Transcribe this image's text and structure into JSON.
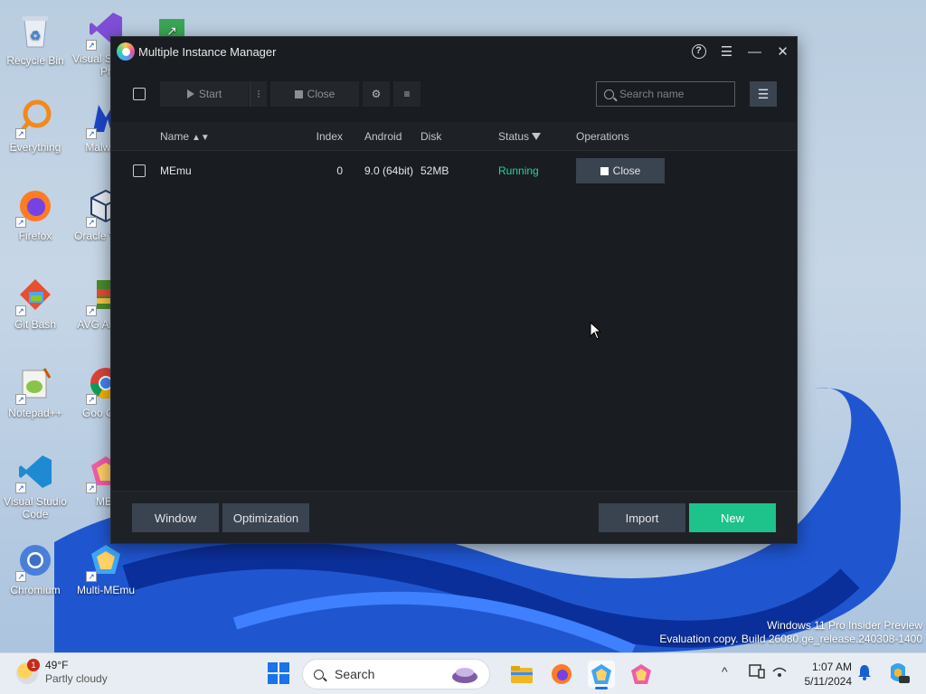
{
  "desktop": {
    "icons": [
      {
        "label": "Recycle Bin",
        "icon": "recycle-bin-icon"
      },
      {
        "label": "Visual S 2022 Pr",
        "icon": "visual-studio-icon"
      },
      {
        "label": "Everything",
        "icon": "everything-search-icon"
      },
      {
        "label": "Malware",
        "icon": "malwarebytes-icon"
      },
      {
        "label": "Firefox",
        "icon": "firefox-icon"
      },
      {
        "label": "Oracle Virtua",
        "icon": "virtualbox-icon"
      },
      {
        "label": "Git Bash",
        "icon": "git-bash-icon"
      },
      {
        "label": "AVG An Fre",
        "icon": "avg-antivirus-icon"
      },
      {
        "label": "Notepad++",
        "icon": "notepad-plus-plus-icon"
      },
      {
        "label": "Goo Chro",
        "icon": "google-chrome-icon"
      },
      {
        "label": "Visual Studio Code",
        "icon": "vscode-icon"
      },
      {
        "label": "MEr",
        "icon": "memu-icon"
      },
      {
        "label": "Chromium",
        "icon": "chromium-icon"
      },
      {
        "label": "Multi-MEmu",
        "icon": "multi-memu-icon"
      }
    ],
    "watermark_line1": "Windows 11 Pro Insider Preview",
    "watermark_line2": "Evaluation copy. Build 26080.ge_release.240308-1400"
  },
  "window": {
    "title": "Multiple Instance Manager",
    "help_label": "?",
    "menu_label": "☰",
    "minimize_label": "—",
    "close_label": "✕"
  },
  "toolbar": {
    "start_label": "Start",
    "more_label": "⁝",
    "close_label": "Close",
    "gear_label": "⚙",
    "menu_label": "≡",
    "search_placeholder": "Search name",
    "view_label": "☰"
  },
  "table": {
    "columns": {
      "name": "Name",
      "index": "Index",
      "android": "Android",
      "disk": "Disk",
      "status": "Status",
      "operations": "Operations"
    },
    "rows": [
      {
        "name": "MEmu",
        "index": "0",
        "android": "9.0 (64bit)",
        "disk": "52MB",
        "status": "Running",
        "op_label": "Close"
      }
    ]
  },
  "footer": {
    "window_label": "Window",
    "optimization_label": "Optimization",
    "import_label": "Import",
    "new_label": "New"
  },
  "taskbar": {
    "weather_temp": "49°F",
    "weather_desc": "Partly cloudy",
    "weather_badge": "1",
    "search_label": "Search",
    "time": "1:07 AM",
    "date": "5/11/2024",
    "tray_chevron": "^",
    "colors": {
      "accent": "#1a73e8",
      "new_button": "#1ec28b",
      "running": "#27d39a"
    }
  }
}
